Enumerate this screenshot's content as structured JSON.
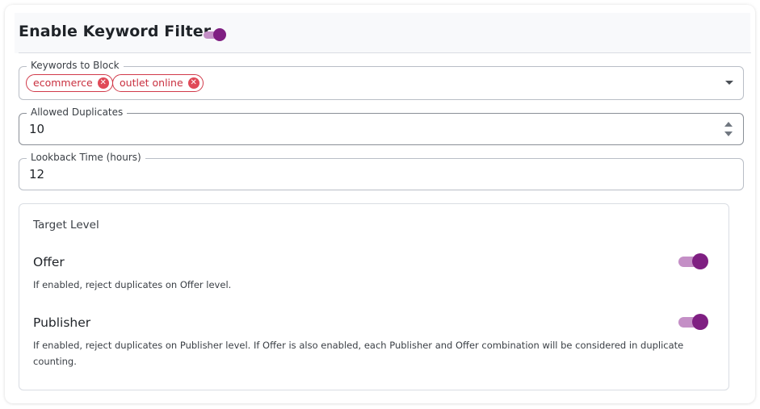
{
  "header": {
    "title": "Enable Keyword Filter",
    "enabled": true
  },
  "keywords": {
    "label": "Keywords to Block",
    "chips": [
      "ecommerce",
      "outlet online"
    ]
  },
  "allowed_duplicates": {
    "label": "Allowed Duplicates",
    "value": "10"
  },
  "lookback": {
    "label": "Lookback Time (hours)",
    "value": "12"
  },
  "target_level": {
    "title": "Target Level",
    "options": [
      {
        "title": "Offer",
        "description": "If enabled, reject duplicates on Offer level.",
        "enabled": true
      },
      {
        "title": "Publisher",
        "description": "If enabled, reject duplicates on Publisher level. If Offer is also enabled, each Publisher and Offer combination will be considered in duplicate counting.",
        "enabled": true
      }
    ]
  },
  "colors": {
    "accent": "#7f1f82",
    "accent_track": "#c48fc6",
    "chip": "#d13a4a"
  }
}
